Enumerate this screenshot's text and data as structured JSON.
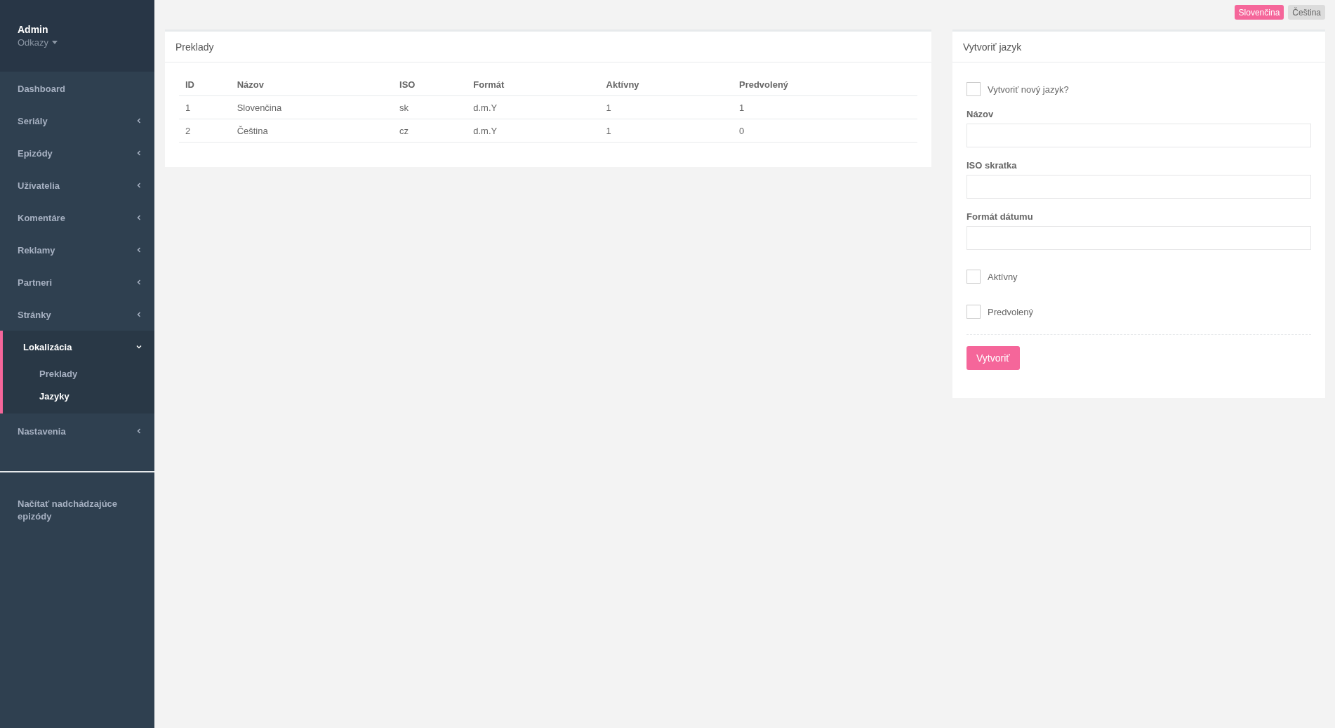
{
  "user": {
    "name": "Admin",
    "links": "Odkazy"
  },
  "nav": [
    {
      "label": "Dashboard",
      "kind": "link",
      "selected": false
    },
    {
      "label": "Seriály",
      "kind": "group",
      "expanded": false,
      "selected": false
    },
    {
      "label": "Epizódy",
      "kind": "group",
      "expanded": false,
      "selected": false
    },
    {
      "label": "Užívatelia",
      "kind": "group",
      "expanded": false,
      "selected": false
    },
    {
      "label": "Komentáre",
      "kind": "group",
      "expanded": false,
      "selected": false
    },
    {
      "label": "Reklamy",
      "kind": "group",
      "expanded": false,
      "selected": false
    },
    {
      "label": "Partneri",
      "kind": "group",
      "expanded": false,
      "selected": false
    },
    {
      "label": "Stránky",
      "kind": "group",
      "expanded": false,
      "selected": false
    },
    {
      "label": "Lokalizácia",
      "kind": "group",
      "expanded": true,
      "selected": true,
      "children": [
        {
          "label": "Preklady",
          "selected": false
        },
        {
          "label": "Jazyky",
          "selected": true
        }
      ]
    },
    {
      "label": "Nastavenia",
      "kind": "group",
      "expanded": false,
      "selected": false
    }
  ],
  "sidebar_action": "Načítať nadchádzajúce epizódy",
  "languages": [
    {
      "label": "Slovenčina",
      "selected": true
    },
    {
      "label": "Čeština",
      "selected": false
    }
  ],
  "table_panel": {
    "title": "Preklady",
    "columns": [
      "ID",
      "Názov",
      "ISO",
      "Formát",
      "Aktívny",
      "Predvolený"
    ],
    "rows": [
      [
        "1",
        "Slovenčina",
        "sk",
        "d.m.Y",
        "1",
        "1"
      ],
      [
        "2",
        "Čeština",
        "cz",
        "d.m.Y",
        "1",
        "0"
      ]
    ]
  },
  "form_panel": {
    "title": "Vytvoriť jazyk",
    "new_language": {
      "label": "Vytvoriť nový jazyk?",
      "checked": false
    },
    "fields": [
      {
        "label": "Názov"
      },
      {
        "label": "ISO skratka"
      },
      {
        "label": "Formát dátumu"
      }
    ],
    "checkboxes": [
      {
        "label": "Aktívny",
        "checked": false
      },
      {
        "label": "Predvolený",
        "checked": false
      }
    ],
    "submit": "Vytvoriť"
  }
}
